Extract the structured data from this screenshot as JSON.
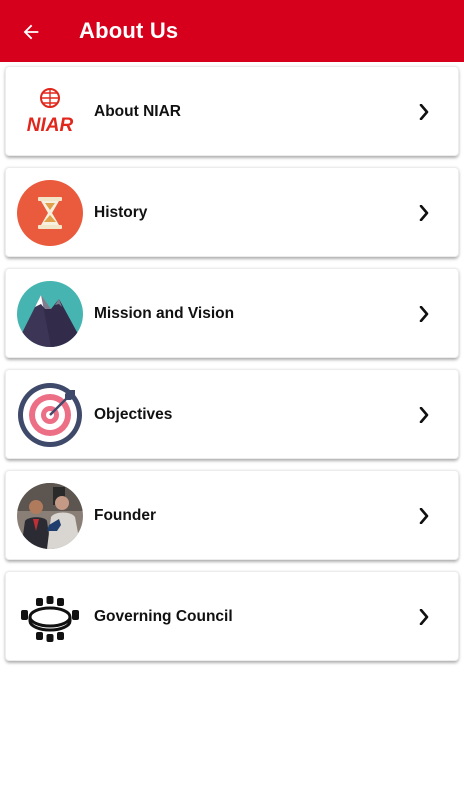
{
  "appbar": {
    "title": "About Us",
    "back_icon": "arrow-left-icon",
    "color": "#d6001c"
  },
  "items": [
    {
      "label": "About NIAR",
      "icon": "niar-logo-icon"
    },
    {
      "label": "History",
      "icon": "hourglass-icon"
    },
    {
      "label": "Mission and Vision",
      "icon": "mountain-icon"
    },
    {
      "label": "Objectives",
      "icon": "target-icon"
    },
    {
      "label": "Founder",
      "icon": "founder-photo-icon"
    },
    {
      "label": "Governing Council",
      "icon": "conference-table-icon"
    }
  ],
  "niar_logo_text": "NIAR"
}
